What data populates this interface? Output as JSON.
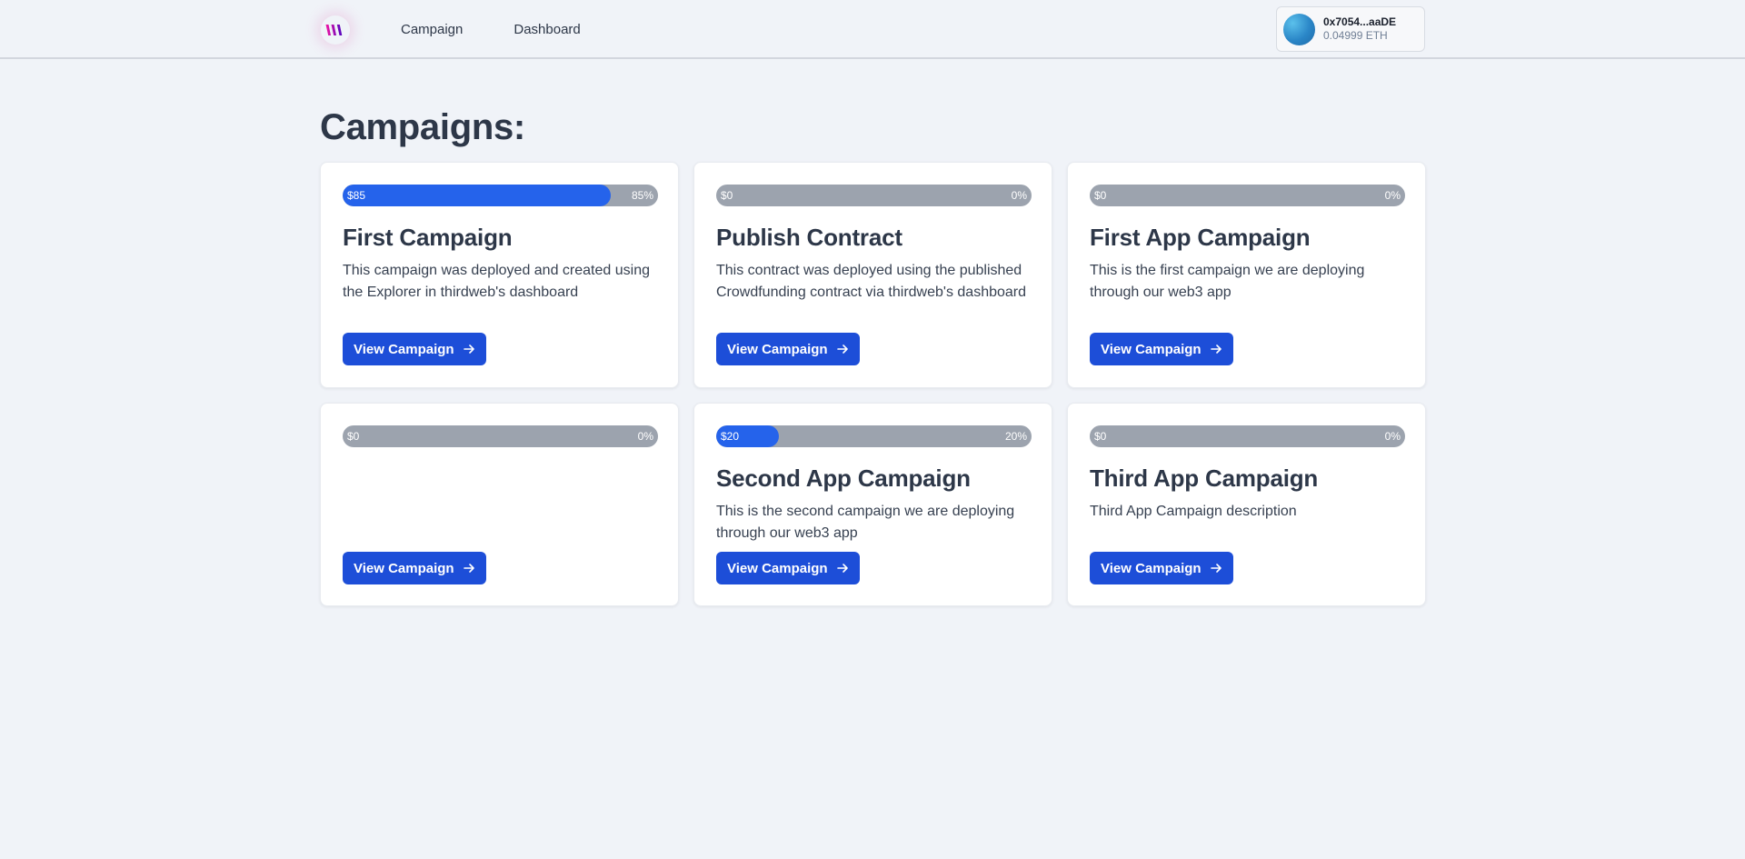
{
  "nav": {
    "logo_icon": "thirdweb-logo-icon",
    "links": [
      "Campaign",
      "Dashboard"
    ]
  },
  "wallet": {
    "address": "0x7054...aaDE",
    "balance": "0.04999 ETH",
    "avatar_icon": "wallet-avatar-icon"
  },
  "page": {
    "title": "Campaigns:"
  },
  "colors": {
    "accent": "#1d4ed8",
    "progress_fill": "#2563eb",
    "progress_track": "#9ca3ae",
    "background": "#f0f3f8"
  },
  "campaigns": [
    {
      "amount": "$85",
      "percent": "85%",
      "progress_fraction": 0.85,
      "title": "First Campaign",
      "description": "This campaign was deployed and created using the Explorer in thirdweb's dashboard",
      "button_label": "View Campaign"
    },
    {
      "amount": "$0",
      "percent": "0%",
      "progress_fraction": 0,
      "title": "Publish Contract",
      "description": "This contract was deployed using the published Crowdfunding contract via thirdweb's dashboard",
      "button_label": "View Campaign"
    },
    {
      "amount": "$0",
      "percent": "0%",
      "progress_fraction": 0,
      "title": "First App Campaign",
      "description": "This is the first campaign we are deploying through our web3 app",
      "button_label": "View Campaign"
    },
    {
      "amount": "$0",
      "percent": "0%",
      "progress_fraction": 0,
      "title": "",
      "description": "",
      "button_label": "View Campaign"
    },
    {
      "amount": "$20",
      "percent": "20%",
      "progress_fraction": 0.2,
      "title": "Second App Campaign",
      "description": "This is the second campaign we are deploying through our web3 app",
      "button_label": "View Campaign"
    },
    {
      "amount": "$0",
      "percent": "0%",
      "progress_fraction": 0,
      "title": "Third App Campaign",
      "description": "Third App Campaign description",
      "button_label": "View Campaign"
    }
  ]
}
